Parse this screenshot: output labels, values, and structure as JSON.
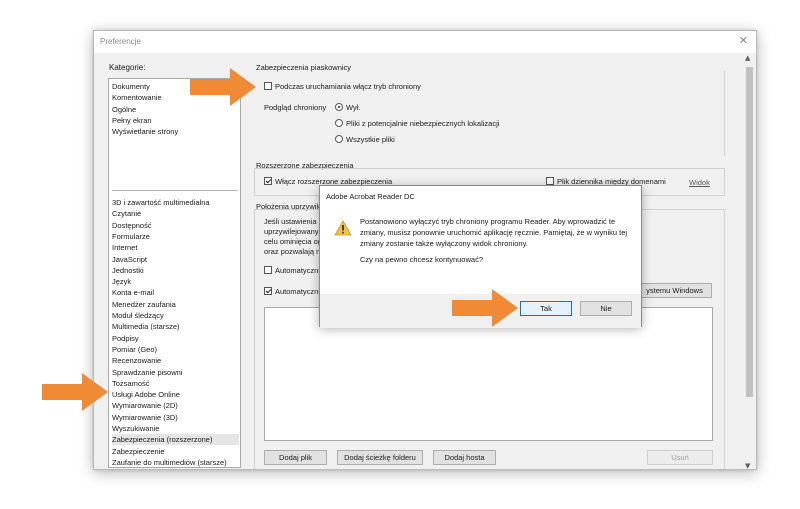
{
  "window": {
    "title": "Preferencje",
    "close_glyph": "✕"
  },
  "categories": {
    "label": "Kategorie:",
    "items_top": [
      "Dokumenty",
      "Komentowanie",
      "Ogólne",
      "Pełny ekran",
      "Wyświetlanie strony"
    ],
    "items_bottom": [
      "3D i zawartość multimedialna",
      "Czytanie",
      "Dostępność",
      "Formularze",
      "Internet",
      "JavaScript",
      "Jednostki",
      "Język",
      "Konta e-mail",
      "Menedżer zaufania",
      "Moduł śledzący",
      "Multimedia (starsze)",
      "Podpisy",
      "Pomiar (Geo)",
      "Recenzowanie",
      "Sprawdzanie pisowni",
      "Tożsamość",
      "Usługi Adobe Online",
      "Wymiarowanie (2D)",
      "Wymiarowanie (3D)",
      "Wyszukiwanie",
      "Zabezpieczenia (rozszerzone)",
      "Zabezpieczenie",
      "Zaufanie do multimediów (starsze)"
    ],
    "selected": "Zabezpieczenia (rozszerzone)"
  },
  "sandbox": {
    "title": "Zabezpieczenia piaskownicy",
    "protected_mode_label": "Podczas uruchamiania włącz tryb chroniony",
    "protected_mode_checked": false,
    "protected_view_label": "Podgląd chroniony",
    "options": [
      "Wył.",
      "Pliki z potencjalnie niebezpiecznych lokalizacji",
      "Wszystkie pliki"
    ],
    "selected_option": "Wył."
  },
  "enhanced": {
    "title": "Rozszerzone zabezpieczenia",
    "enable_label": "Włącz rozszerzone zabezpieczenia",
    "enable_checked": true,
    "log_label": "Plik dziennika między domenami",
    "log_checked": false,
    "view_link": "Widok"
  },
  "privileged": {
    "title": "Położenia uprzywilejowane",
    "desc_lines": [
      "Jeśli ustawienia za",
      "uprzywilejowanych",
      "celu ominięcia og",
      "oraz pozwalają na"
    ],
    "auto_trust_1": "Automatyczni",
    "auto_trust_1_checked": false,
    "auto_trust_2": "Automatyczni",
    "auto_trust_2_checked": true,
    "windows_button": "ystemu Windows"
  },
  "buttons": {
    "add_file": "Dodaj plik",
    "add_folder": "Dodaj ścieżkę folderu",
    "add_host": "Dodaj hosta",
    "remove": "Usuń"
  },
  "dialog": {
    "title": "Adobe Acrobat Reader DC",
    "message": "Postanowiono wyłączyć tryb chroniony programu Reader. Aby wprowadzić te zmiany, musisz ponownie uruchomić aplikację ręcznie. Pamiętaj, że w wyniku tej zmiany zostanie także wyłączony widok chroniony.",
    "question": "Czy na pewno chcesz kontynuować?",
    "yes_label": "Tak",
    "no_label": "Nie",
    "icon": "warning-icon"
  },
  "colors": {
    "arrow": "#f08a35",
    "accent_focus": "#0078d7"
  },
  "icons": {
    "arrow": "orange-arrow-icon",
    "scroll_up": "▲",
    "scroll_down": "▼"
  }
}
